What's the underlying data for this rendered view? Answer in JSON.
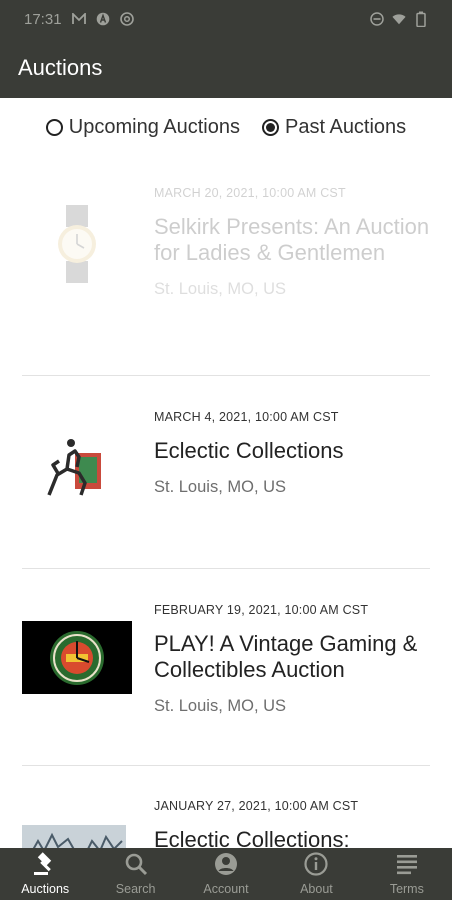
{
  "status_bar": {
    "time": "17:31",
    "icons_left": [
      "m-icon",
      "a-icon",
      "at-icon"
    ],
    "icons_right": [
      "do-not-disturb-icon",
      "wifi-icon",
      "battery-icon"
    ]
  },
  "app_bar": {
    "title": "Auctions"
  },
  "filter": {
    "options": [
      {
        "label": "Upcoming Auctions",
        "selected": false
      },
      {
        "label": "Past Auctions",
        "selected": true
      }
    ]
  },
  "auctions": [
    {
      "date": "MARCH 20, 2021, 10:00 AM CST",
      "title": "Selkirk Presents: An Auction for Ladies & Gentlemen",
      "location": "St. Louis, MO, US",
      "thumb": "watch-image"
    },
    {
      "date": "MARCH 4, 2021, 10:00 AM CST",
      "title": "Eclectic Collections",
      "location": "St. Louis, MO, US",
      "thumb": "horse-statue-image"
    },
    {
      "date": "FEBRUARY 19, 2021, 10:00 AM CST",
      "title": "PLAY! A Vintage Gaming & Collectibles Auction",
      "location": "St. Louis, MO, US",
      "thumb": "gaming-clock-image"
    },
    {
      "date": "JANUARY 27, 2021, 10:00 AM CST",
      "title": "Eclectic Collections:",
      "location": "",
      "thumb": "print-image"
    }
  ],
  "bottom_nav": [
    {
      "label": "Auctions",
      "icon": "gavel-icon",
      "active": true
    },
    {
      "label": "Search",
      "icon": "search-icon",
      "active": false
    },
    {
      "label": "Account",
      "icon": "account-icon",
      "active": false
    },
    {
      "label": "About",
      "icon": "info-icon",
      "active": false
    },
    {
      "label": "Terms",
      "icon": "terms-icon",
      "active": false
    }
  ],
  "colors": {
    "bar": "#3a3c37",
    "active": "#ffffff",
    "inactive": "#9a9c95"
  }
}
